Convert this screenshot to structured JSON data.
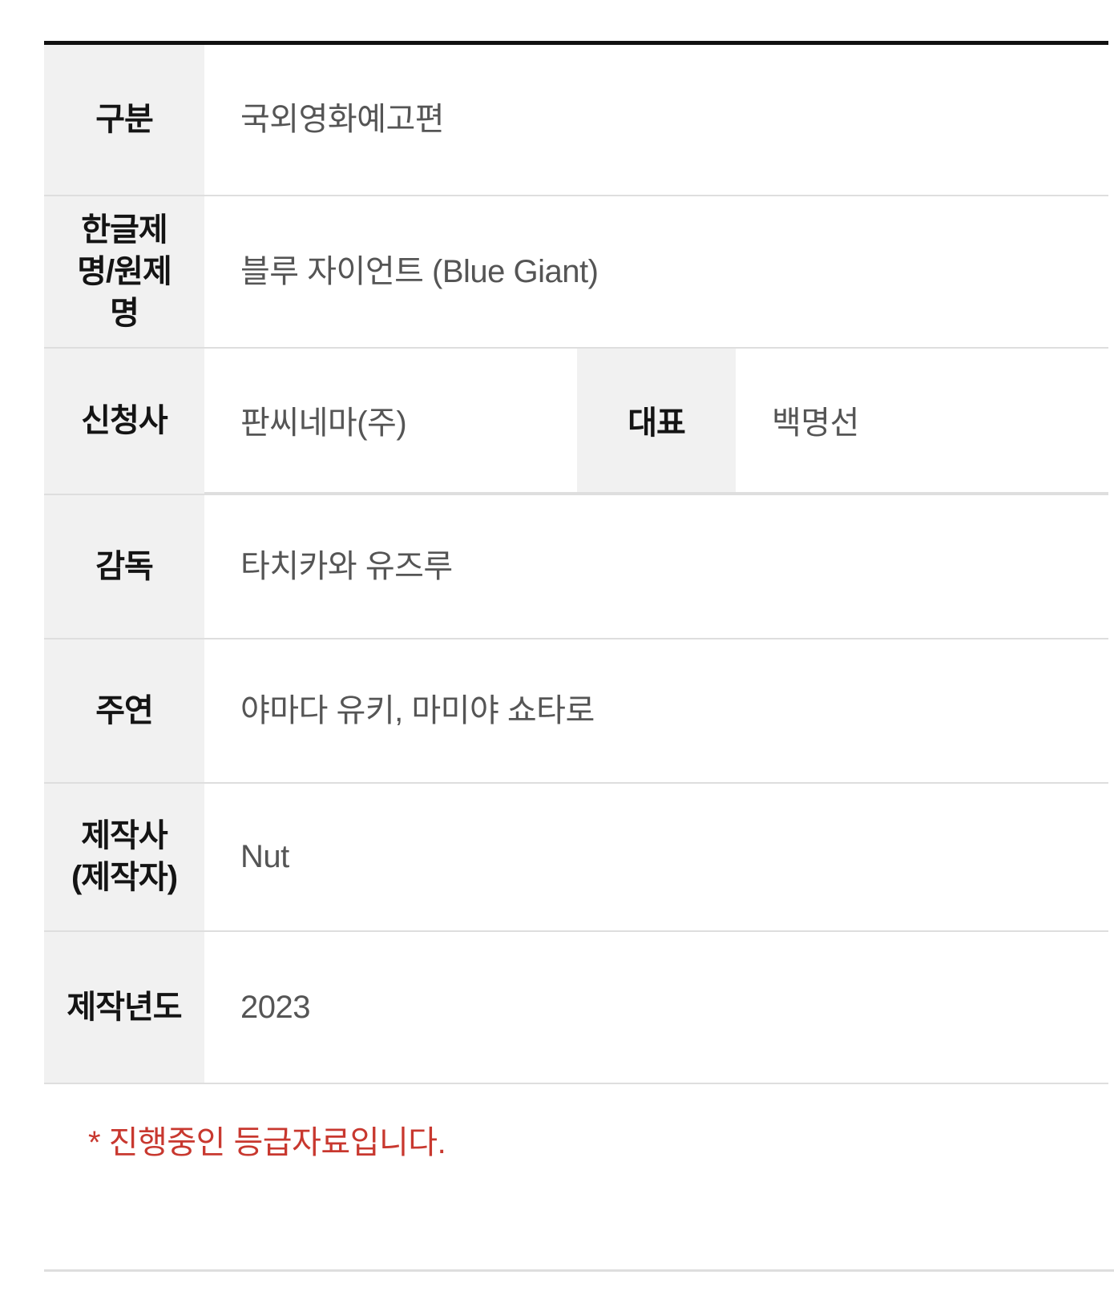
{
  "table": {
    "rows": [
      {
        "header": "구분",
        "value": "국외영화예고편"
      },
      {
        "header": "한글제명/원제명",
        "value": "블루 자이언트  (Blue Giant)"
      },
      {
        "header": "신청사",
        "value": "판씨네마(주)",
        "sub_header": "대표",
        "sub_value": "백명선"
      },
      {
        "header": "감독",
        "value": "타치카와 유즈루"
      },
      {
        "header": "주연",
        "value": "야마다 유키, 마미야 쇼타로"
      },
      {
        "header": "제작사(제작자)",
        "value": "Nut"
      },
      {
        "header": "제작년도",
        "value": "2023"
      }
    ],
    "header_lines": {
      "type": "구분",
      "title_l1": "한글제",
      "title_l2": "명/원제",
      "title_l3": "명",
      "applicant": "신청사",
      "representative": "대표",
      "director": "감독",
      "cast": "주연",
      "producer_l1": "제작사",
      "producer_l2": "(제작자)",
      "year": "제작년도"
    }
  },
  "notice": {
    "text": "* 진행중인 등급자료입니다."
  },
  "colors": {
    "top_border": "#111111",
    "row_divider": "#dedede",
    "header_bg": "#f1f1f1",
    "header_text": "#141414",
    "value_text": "#555555",
    "notice_text": "#c8382f"
  }
}
